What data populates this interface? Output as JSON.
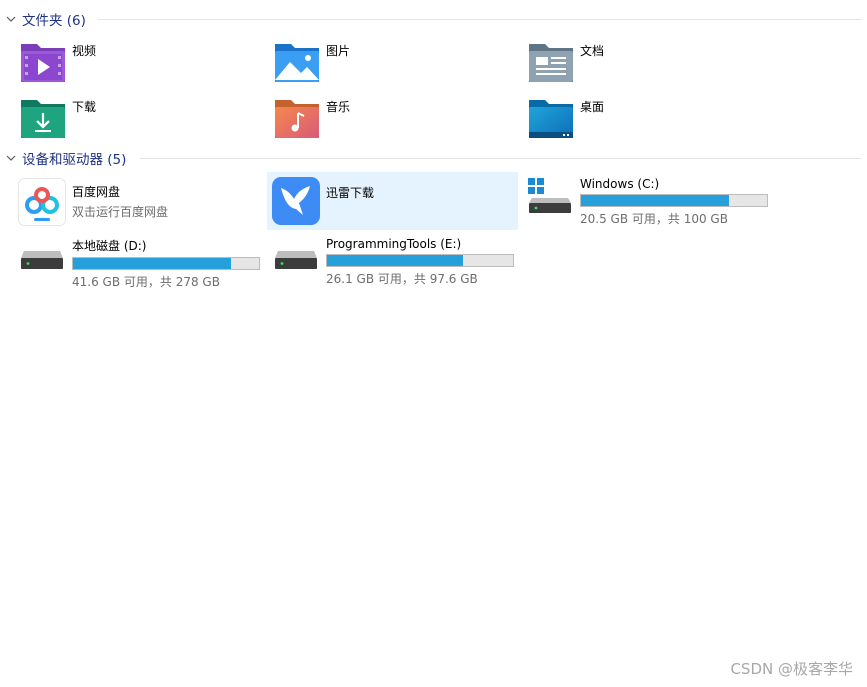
{
  "folders_section": {
    "title": "文件夹 (6)"
  },
  "folders": [
    {
      "name": "视频",
      "icon": "video-folder-icon"
    },
    {
      "name": "图片",
      "icon": "pictures-folder-icon"
    },
    {
      "name": "文档",
      "icon": "documents-folder-icon"
    },
    {
      "name": "下载",
      "icon": "downloads-folder-icon"
    },
    {
      "name": "音乐",
      "icon": "music-folder-icon"
    },
    {
      "name": "桌面",
      "icon": "desktop-folder-icon"
    }
  ],
  "devices_section": {
    "title": "设备和驱动器 (5)"
  },
  "devices": {
    "baidu": {
      "name": "百度网盘",
      "subtitle": "双击运行百度网盘",
      "icon": "baidu-netdisk-icon"
    },
    "xunlei": {
      "name": "迅雷下载",
      "icon": "xunlei-icon"
    },
    "c_drive": {
      "name": "Windows (C:)",
      "usage": "20.5 GB 可用，共 100 GB",
      "used_fraction": 0.795,
      "icon": "windows-drive-icon"
    },
    "d_drive": {
      "name": "本地磁盘 (D:)",
      "usage": "41.6 GB 可用，共 278 GB",
      "used_fraction": 0.85,
      "icon": "hard-drive-icon"
    },
    "e_drive": {
      "name": "ProgrammingTools (E:)",
      "usage": "26.1 GB 可用，共 97.6 GB",
      "used_fraction": 0.733,
      "icon": "hard-drive-icon"
    }
  },
  "colors": {
    "accent": "#26a0da",
    "header": "#1e3287",
    "selection": "#e5f3ff"
  },
  "watermark": "CSDN @极客李华"
}
